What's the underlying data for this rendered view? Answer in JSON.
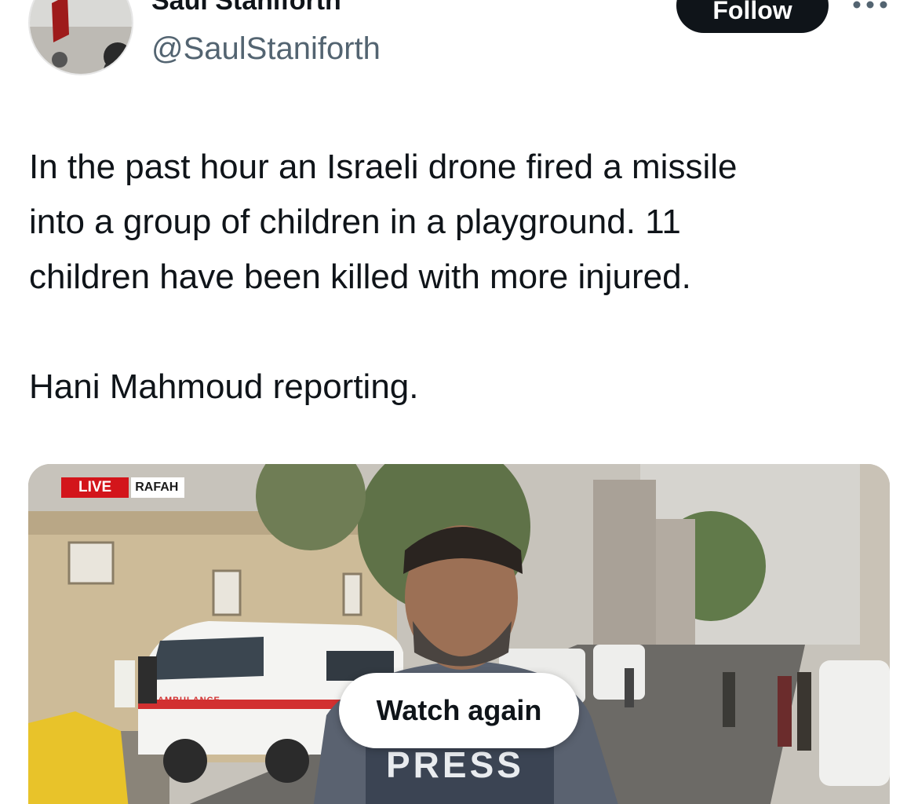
{
  "header": {
    "display_name": "Saul Staniforth",
    "handle": "@SaulStaniforth",
    "follow_label": "Follow",
    "more_icon": "more-horizontal-icon"
  },
  "tweet": {
    "text": "In the past hour an Israeli drone fired a missile\ninto a group of children in a playground. 11\nchildren have been killed with more injured.\n\nHani Mahmoud reporting."
  },
  "media": {
    "live_label": "LIVE",
    "location_label": "RAFAH",
    "watch_again_label": "Watch again",
    "vest_text": "PRESS",
    "ambulance_text": "AMBULANCE",
    "colors": {
      "live_red": "#d3151b",
      "follow_bg": "#0f1419"
    }
  }
}
